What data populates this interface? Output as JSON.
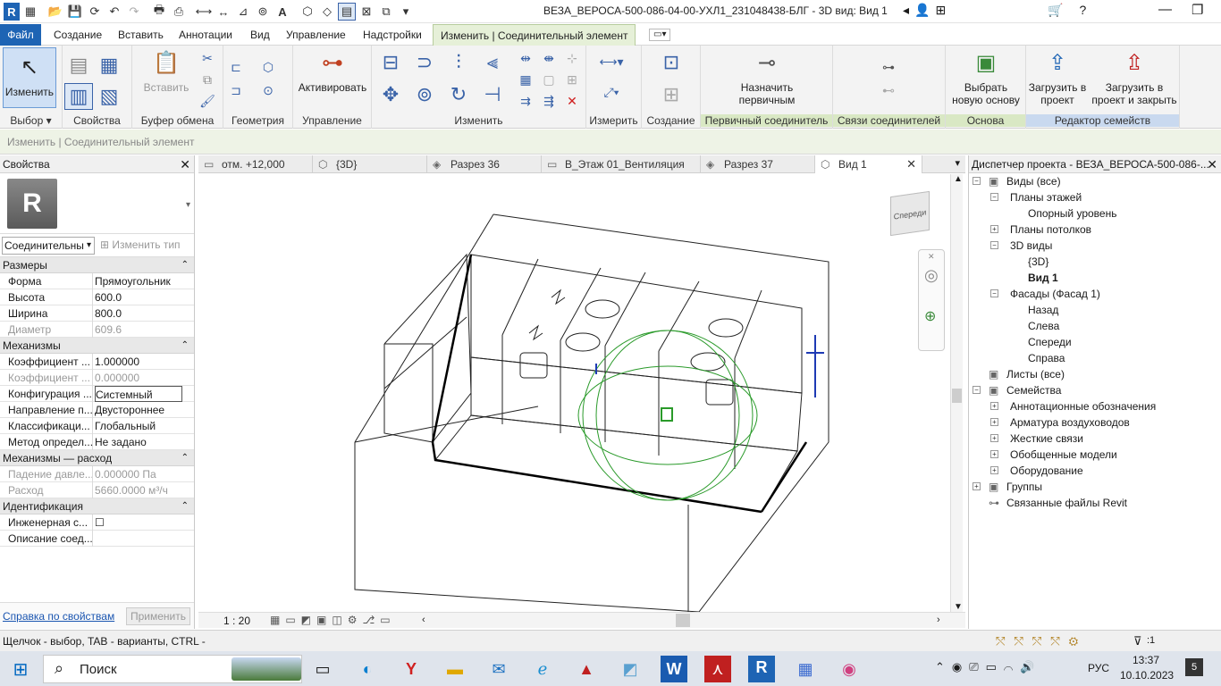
{
  "app": {
    "title": "ВЕЗА_ВЕРОСА-500-086-04-00-УХЛ1_231048438-БЛГ - 3D вид: Вид 1"
  },
  "ribbon_tabs": [
    "Файл",
    "Создание",
    "Вставить",
    "Аннотации",
    "Вид",
    "Управление",
    "Надстройки",
    "Изменить | Соединительный элемент"
  ],
  "ribbon": {
    "panels": {
      "select": "Выбор",
      "properties": "Свойства",
      "clipboard": "Буфер обмена",
      "geometry": "Геометрия",
      "control": "Управление",
      "modify": "Изменить",
      "measure": "Измерить",
      "create": "Создание",
      "primary": "Первичный соединитель",
      "links": "Связи соединителей",
      "base": "Основа",
      "family_editor": "Редактор семейств"
    },
    "buttons": {
      "modify": "Изменить",
      "paste": "Вставить",
      "activate": "Активировать",
      "set_primary": "Назначить первичным",
      "pick_base": "Выбрать новую основу",
      "load_project": "Загрузить в проект",
      "load_close": "Загрузить в проект и закрыть"
    }
  },
  "context_bar": "Изменить | Соединительный элемент",
  "properties": {
    "title": "Свойства",
    "type_selector": "Соединительны",
    "edit_type": "Изменить тип",
    "groups": [
      {
        "name": "Размеры",
        "rows": [
          {
            "k": "Форма",
            "v": "Прямоугольник",
            "dis": false
          },
          {
            "k": "Высота",
            "v": "600.0",
            "dis": false
          },
          {
            "k": "Ширина",
            "v": "800.0",
            "dis": false
          },
          {
            "k": "Диаметр",
            "v": "609.6",
            "dis": true
          }
        ]
      },
      {
        "name": "Механизмы",
        "rows": [
          {
            "k": "Коэффициент ...",
            "v": "1.000000",
            "dis": false
          },
          {
            "k": "Коэффициент ...",
            "v": "0.000000",
            "dis": true
          },
          {
            "k": "Конфигурация ...",
            "v": "Системный",
            "dis": false,
            "sel": true
          },
          {
            "k": "Направление п...",
            "v": "Двустороннее",
            "dis": false
          },
          {
            "k": "Классификаци...",
            "v": "Глобальный",
            "dis": false
          },
          {
            "k": "Метод определ...",
            "v": "Не задано",
            "dis": false
          }
        ]
      },
      {
        "name": "Механизмы — расход",
        "rows": [
          {
            "k": "Падение давле...",
            "v": "0.000000 Па",
            "dis": true
          },
          {
            "k": "Расход",
            "v": "5660.0000 м³/ч",
            "dis": true
          }
        ]
      },
      {
        "name": "Идентификация",
        "rows": [
          {
            "k": "Инженерная с...",
            "v": "☐",
            "dis": false
          },
          {
            "k": "Описание соед...",
            "v": "",
            "dis": false
          }
        ]
      }
    ],
    "help_link": "Справка по свойствам",
    "apply": "Применить"
  },
  "view_tabs": [
    {
      "label": "отм. +12,000",
      "icon": "▭"
    },
    {
      "label": "{3D}",
      "icon": "⬡"
    },
    {
      "label": "Разрез 36",
      "icon": "◈"
    },
    {
      "label": "В_Этаж 01_Вентиляция",
      "icon": "▭"
    },
    {
      "label": "Разрез 37",
      "icon": "◈"
    },
    {
      "label": "Вид 1",
      "icon": "⬡"
    }
  ],
  "viewcube_label": "Спереди",
  "scale": "1 : 20",
  "project_browser": {
    "title": "Диспетчер проекта - ВЕЗА_ВЕРОСА-500-086-...",
    "nodes": [
      {
        "label": "Виды (все)",
        "lvl": 0,
        "exp": "−"
      },
      {
        "label": "Планы этажей",
        "lvl": 1,
        "exp": "−"
      },
      {
        "label": "Опорный уровень",
        "lvl": 2,
        "exp": ""
      },
      {
        "label": "Планы потолков",
        "lvl": 1,
        "exp": "+"
      },
      {
        "label": "3D виды",
        "lvl": 1,
        "exp": "−"
      },
      {
        "label": "{3D}",
        "lvl": 2,
        "exp": ""
      },
      {
        "label": "Вид 1",
        "lvl": 2,
        "exp": "",
        "bold": true
      },
      {
        "label": "Фасады (Фасад 1)",
        "lvl": 1,
        "exp": "−"
      },
      {
        "label": "Назад",
        "lvl": 2,
        "exp": ""
      },
      {
        "label": "Слева",
        "lvl": 2,
        "exp": ""
      },
      {
        "label": "Спереди",
        "lvl": 2,
        "exp": ""
      },
      {
        "label": "Справа",
        "lvl": 2,
        "exp": ""
      },
      {
        "label": "Листы (все)",
        "lvl": 0,
        "exp": ""
      },
      {
        "label": "Семейства",
        "lvl": 0,
        "exp": "−"
      },
      {
        "label": "Аннотационные обозначения",
        "lvl": 1,
        "exp": "+"
      },
      {
        "label": "Арматура воздуховодов",
        "lvl": 1,
        "exp": "+"
      },
      {
        "label": "Жесткие связи",
        "lvl": 1,
        "exp": "+"
      },
      {
        "label": "Обобщенные модели",
        "lvl": 1,
        "exp": "+"
      },
      {
        "label": "Оборудование",
        "lvl": 1,
        "exp": "+"
      },
      {
        "label": "Группы",
        "lvl": 0,
        "exp": "+"
      },
      {
        "label": "Связанные файлы Revit",
        "lvl": 0,
        "exp": ""
      }
    ]
  },
  "status": {
    "hint": "Щелчок - выбор, TAB - варианты, CTRL -",
    "filter": ":1"
  },
  "taskbar": {
    "search": "Поиск",
    "lang": "РУС",
    "time": "13:37",
    "date": "10.10.2023",
    "notif": "5"
  }
}
